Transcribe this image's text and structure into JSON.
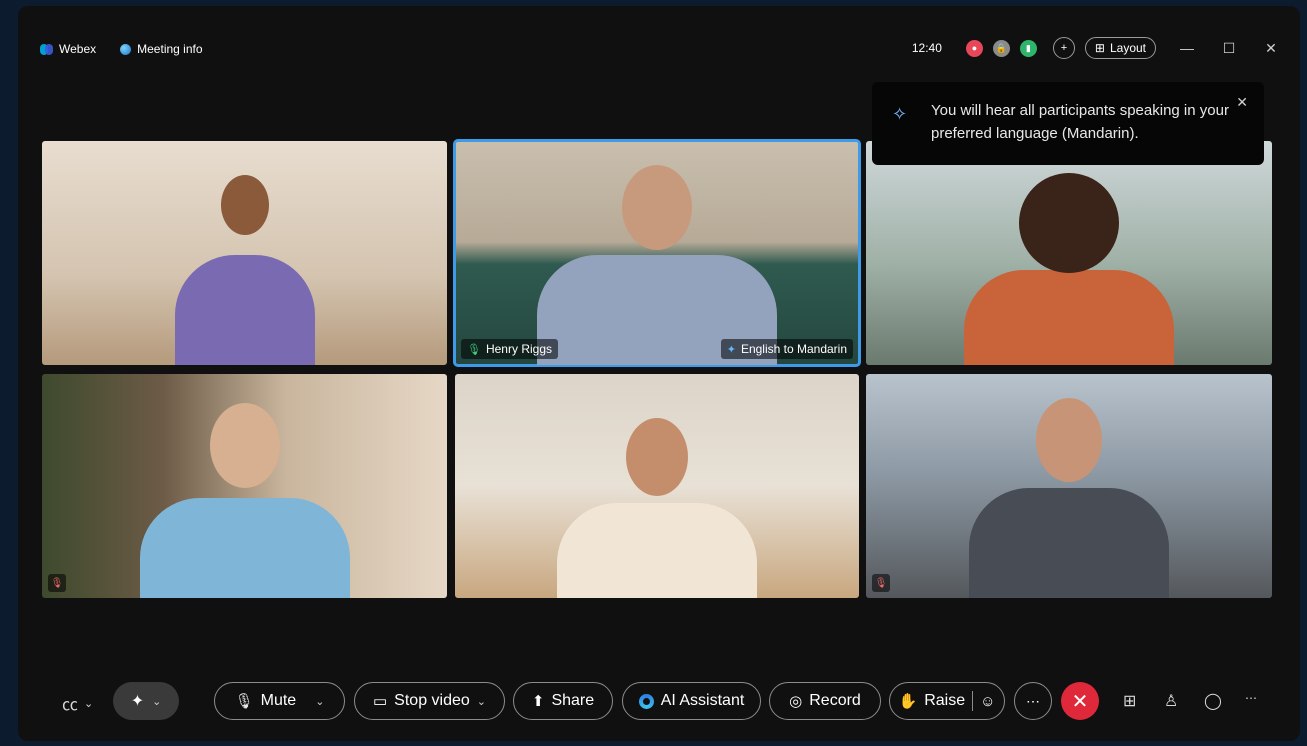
{
  "window": {
    "app_name": "Webex",
    "meeting_info_label": "Meeting info",
    "time": "12:40",
    "layout_label": "Layout"
  },
  "toast": {
    "message": "You will hear all participants speaking in your preferred language (Mandarin)."
  },
  "tiles": [
    {
      "id": 1,
      "name": "",
      "muted": false
    },
    {
      "id": 2,
      "name": "Henry Riggs",
      "translation": "English to Mandarin",
      "active_speaker": true
    },
    {
      "id": 3,
      "name": "",
      "muted": false
    },
    {
      "id": 4,
      "name": "",
      "muted": true
    },
    {
      "id": 5,
      "name": "",
      "muted": false
    },
    {
      "id": 6,
      "name": "",
      "muted": true
    }
  ],
  "controls": {
    "mute_label": "Mute",
    "stop_video_label": "Stop video",
    "share_label": "Share",
    "ai_assistant_label": "AI Assistant",
    "record_label": "Record",
    "raise_label": "Raise"
  },
  "colors": {
    "accent_blue": "#3d9be9",
    "end_call_red": "#e0283b",
    "mic_green": "#3fd07a"
  },
  "icons": [
    "closed-captions-icon",
    "sparkle-icon",
    "microphone-icon",
    "camera-icon",
    "share-icon",
    "ai-assistant-icon",
    "record-icon",
    "hand-icon",
    "emoji-icon",
    "more-icon",
    "end-call-icon",
    "grid-icon",
    "participants-icon",
    "chat-icon"
  ]
}
